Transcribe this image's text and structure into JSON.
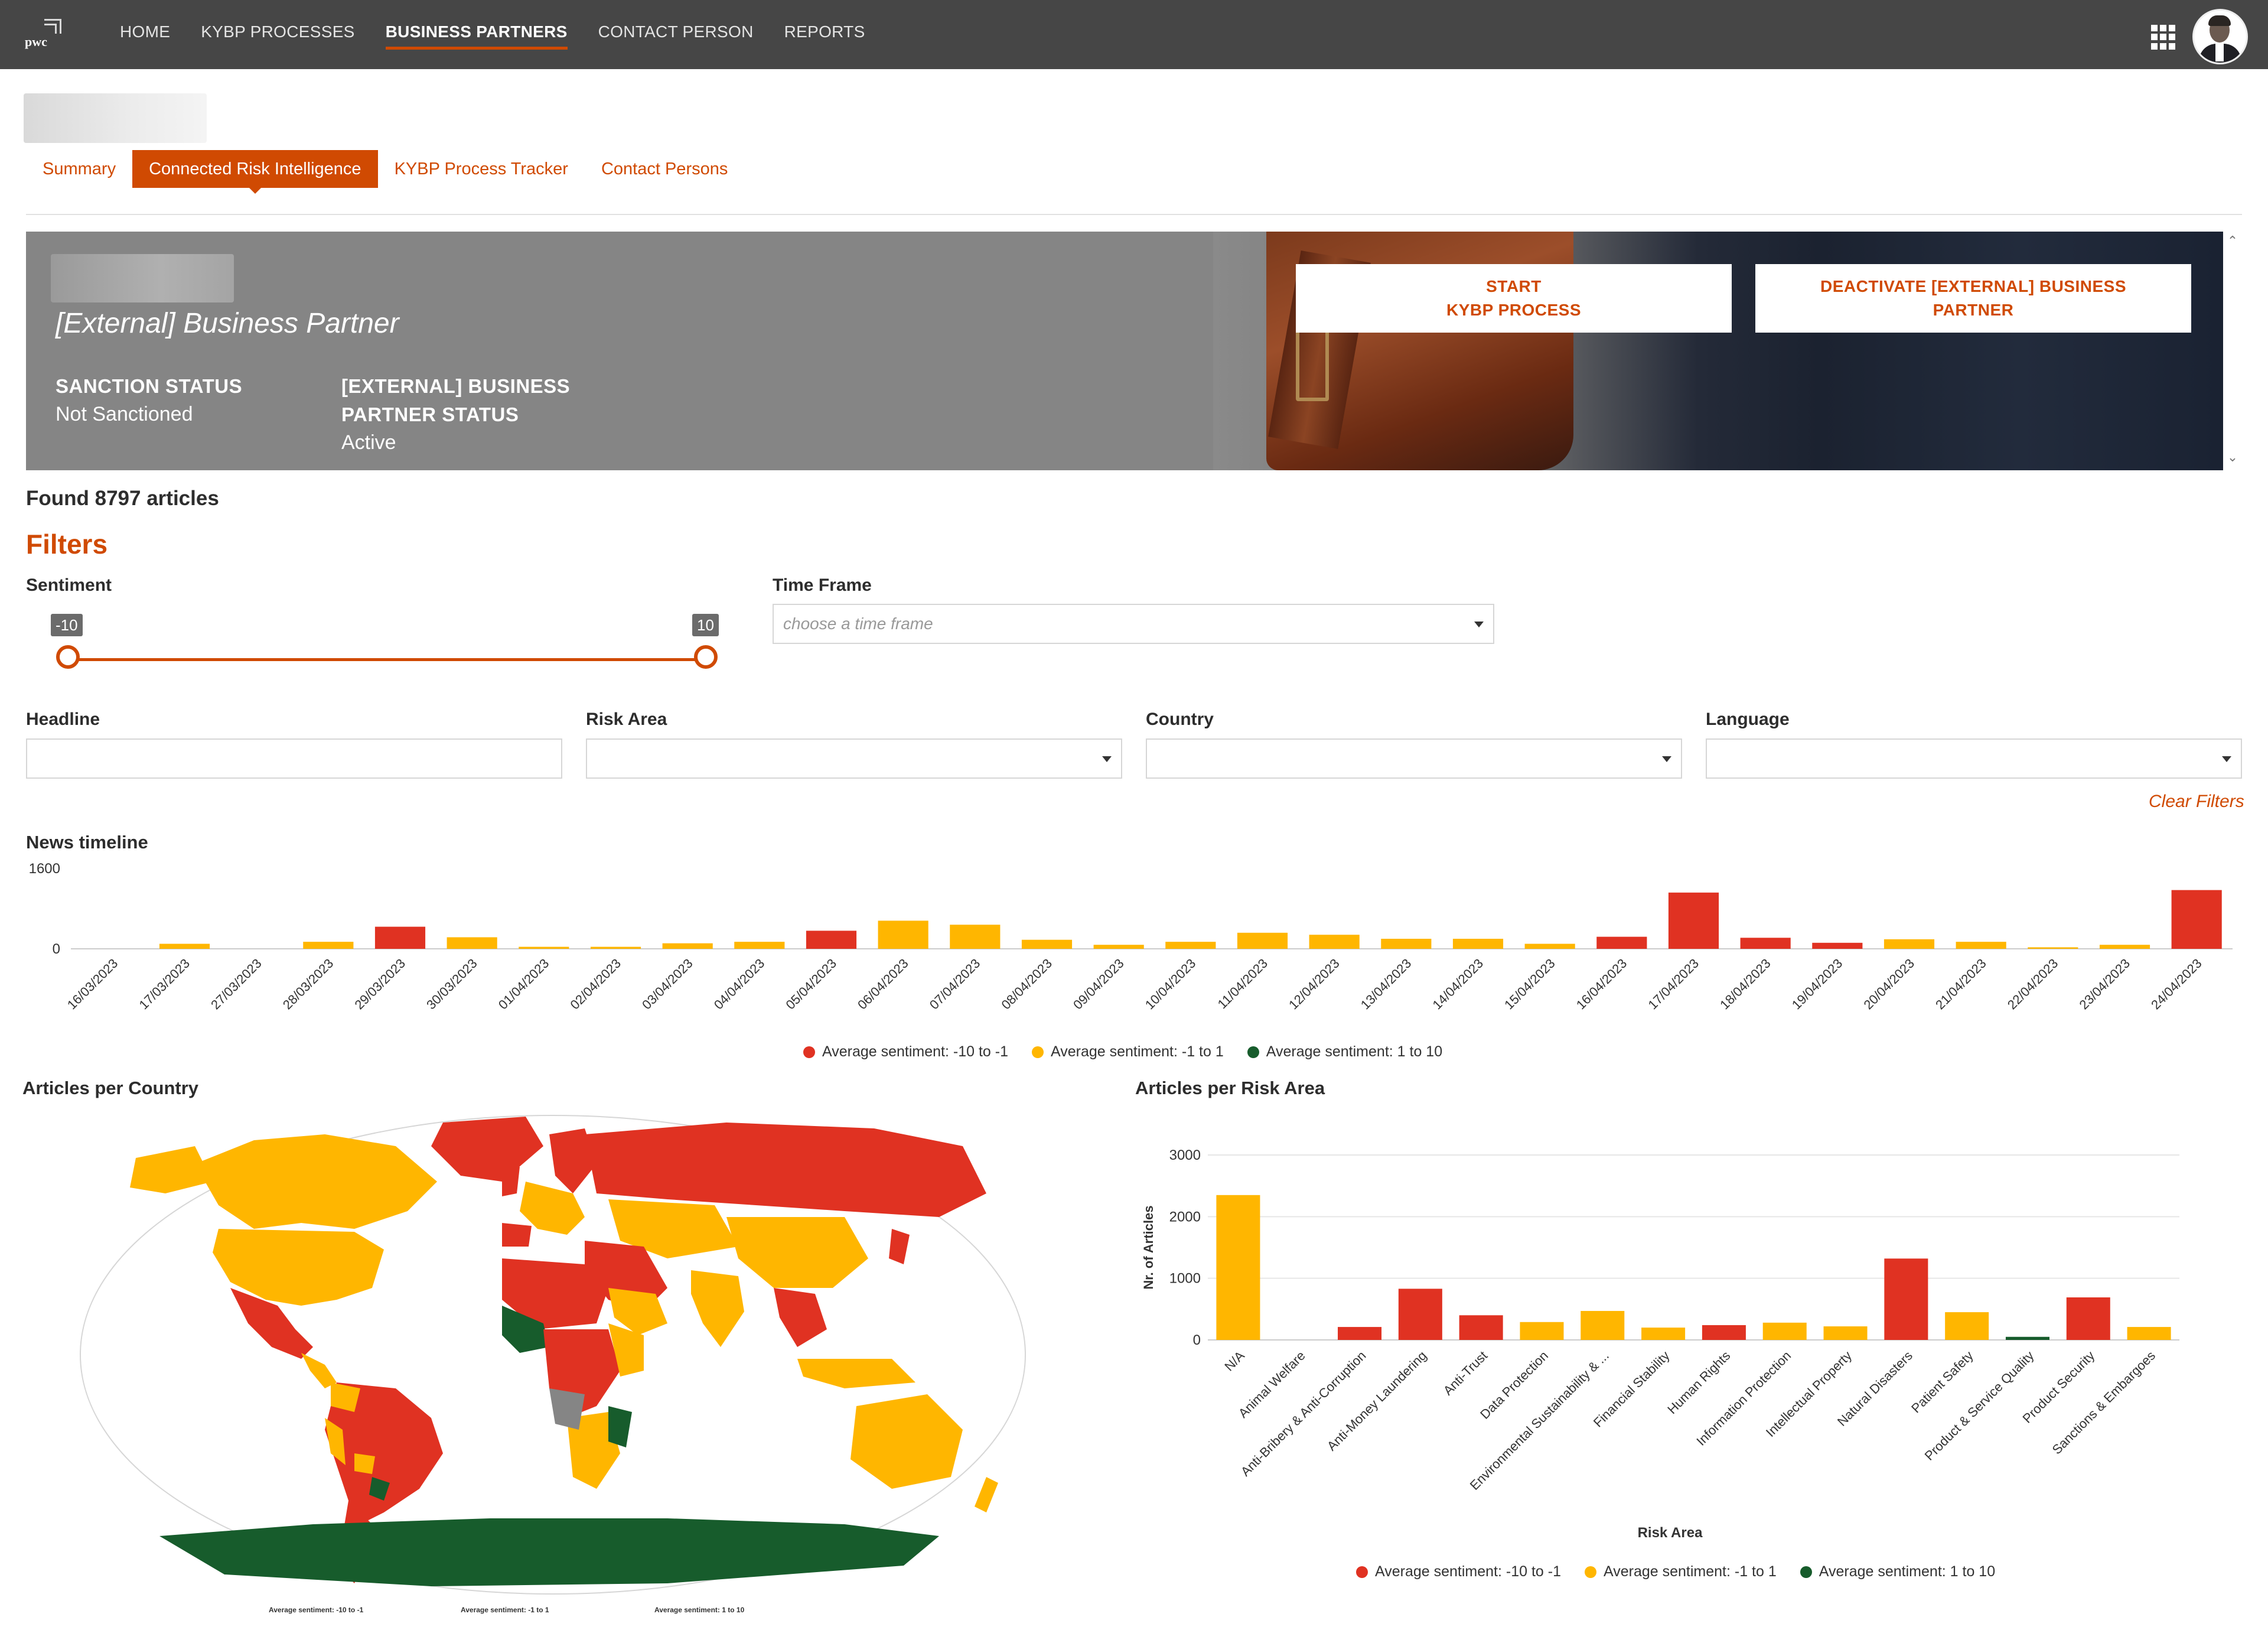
{
  "nav": {
    "logo_text": "pwc",
    "items": [
      "HOME",
      "KYBP PROCESSES",
      "BUSINESS PARTNERS",
      "CONTACT PERSON",
      "REPORTS"
    ],
    "active": "BUSINESS PARTNERS",
    "icons": [
      "apps-grid-icon",
      "user-avatar"
    ]
  },
  "tabs": [
    {
      "label": "Summary",
      "active": false
    },
    {
      "label": "Connected Risk Intelligence",
      "active": true
    },
    {
      "label": "KYBP Process Tracker",
      "active": false
    },
    {
      "label": "Contact Persons",
      "active": false
    }
  ],
  "banner": {
    "title": "[External] Business Partner",
    "sanction_label": "SANCTION STATUS",
    "sanction_value": "Not Sanctioned",
    "bp_status_label_1": "[EXTERNAL] BUSINESS",
    "bp_status_label_2": "PARTNER STATUS",
    "bp_status_value": "Active",
    "btn_start_1": "START",
    "btn_start_2": "KYBP PROCESS",
    "btn_deactivate_1": "DEACTIVATE [EXTERNAL] BUSINESS",
    "btn_deactivate_2": "PARTNER"
  },
  "found_text": "Found 8797 articles",
  "filters": {
    "title": "Filters",
    "sentiment_label": "Sentiment",
    "sentiment_min": "-10",
    "sentiment_max": "10",
    "timeframe_label": "Time Frame",
    "timeframe_placeholder": "choose a time frame",
    "headline_label": "Headline",
    "riskarea_label": "Risk Area",
    "country_label": "Country",
    "language_label": "Language",
    "clear": "Clear Filters"
  },
  "colors": {
    "accent": "#d04a02",
    "negative": "#e03222",
    "neutral": "#ffb600",
    "positive": "#175c2c"
  },
  "chart_data": [
    {
      "type": "bar",
      "title": "News timeline",
      "categories": [
        "16/03/2023",
        "17/03/2023",
        "27/03/2023",
        "28/03/2023",
        "29/03/2023",
        "30/03/2023",
        "01/04/2023",
        "02/04/2023",
        "03/04/2023",
        "04/04/2023",
        "05/04/2023",
        "06/04/2023",
        "07/04/2023",
        "08/04/2023",
        "09/04/2023",
        "10/04/2023",
        "11/04/2023",
        "12/04/2023",
        "13/04/2023",
        "14/04/2023",
        "15/04/2023",
        "16/04/2023",
        "17/04/2023",
        "18/04/2023",
        "19/04/2023",
        "20/04/2023",
        "21/04/2023",
        "22/04/2023",
        "23/04/2023",
        "24/04/2023"
      ],
      "values": [
        0,
        100,
        0,
        140,
        440,
        230,
        40,
        40,
        110,
        140,
        360,
        560,
        480,
        180,
        80,
        140,
        320,
        280,
        200,
        200,
        100,
        240,
        1120,
        220,
        120,
        190,
        140,
        30,
        80,
        1170
      ],
      "sentiment": [
        "neutral",
        "neutral",
        "neutral",
        "neutral",
        "negative",
        "neutral",
        "neutral",
        "neutral",
        "neutral",
        "neutral",
        "negative",
        "neutral",
        "neutral",
        "neutral",
        "neutral",
        "neutral",
        "neutral",
        "neutral",
        "neutral",
        "neutral",
        "neutral",
        "negative",
        "negative",
        "negative",
        "negative",
        "neutral",
        "neutral",
        "neutral",
        "neutral",
        "negative"
      ],
      "ylim": [
        0,
        1600
      ],
      "yticks": [
        "0",
        "1600"
      ],
      "legend": [
        "Average sentiment: -10 to -1",
        "Average sentiment: -1 to 1",
        "Average sentiment: 1 to 10"
      ],
      "legend_position": "bottom"
    },
    {
      "type": "map",
      "title": "Articles per Country",
      "legend": [
        "Average sentiment: -10 to -1",
        "Average sentiment: -1 to 1",
        "Average sentiment: 1 to 10"
      ]
    },
    {
      "type": "bar",
      "title": "Articles per Risk Area",
      "xlabel": "Risk Area",
      "ylabel": "Nr. of Articles",
      "categories": [
        "N/A",
        "Animal Welfare",
        "Anti-Bribery & Anti-Corruption",
        "Anti-Money Laundering",
        "Anti-Trust",
        "Data Protection",
        "Environmental Sustainability & ...",
        "Financial Stability",
        "Human Rights",
        "Information Protection",
        "Intellectual Property",
        "Natural Disasters",
        "Patient Safety",
        "Product & Service Quality",
        "Product Security",
        "Sanctions & Embargoes"
      ],
      "values": [
        2350,
        0,
        210,
        830,
        400,
        290,
        470,
        200,
        240,
        280,
        220,
        1320,
        450,
        50,
        690,
        210
      ],
      "sentiment": [
        "neutral",
        "neutral",
        "negative",
        "negative",
        "negative",
        "neutral",
        "neutral",
        "neutral",
        "negative",
        "neutral",
        "neutral",
        "negative",
        "neutral",
        "positive",
        "negative",
        "neutral"
      ],
      "ylim": [
        0,
        3000
      ],
      "yticks": [
        "0",
        "1000",
        "2000",
        "3000"
      ],
      "grid": true,
      "legend": [
        "Average sentiment: -10 to -1",
        "Average sentiment: -1 to 1",
        "Average sentiment: 1 to 10"
      ],
      "legend_position": "bottom"
    }
  ]
}
